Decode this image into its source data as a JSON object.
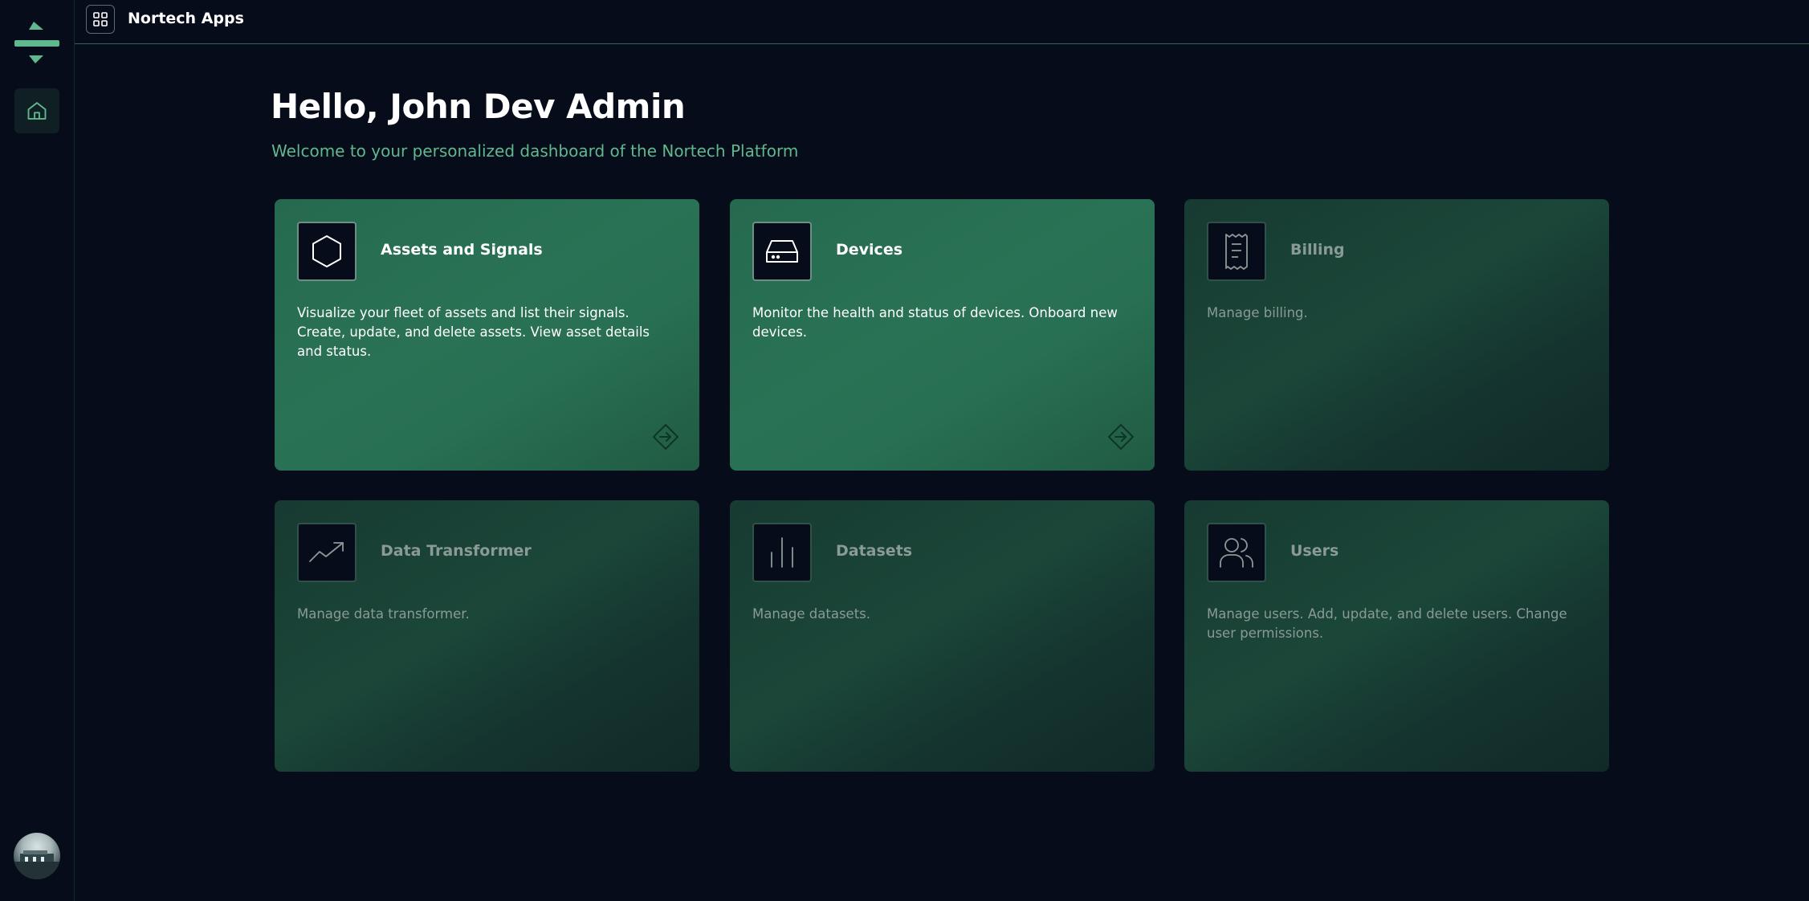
{
  "header": {
    "app_name": "Nortech Apps"
  },
  "main": {
    "greeting": "Hello, John Dev Admin",
    "subtitle": "Welcome to your personalized dashboard of the Nortech Platform"
  },
  "cards": [
    {
      "title": "Assets and Signals",
      "description": "Visualize your fleet of assets and list their signals. Create, update, and delete assets. View asset details and status.",
      "icon": "hexagon-icon",
      "enabled": true
    },
    {
      "title": "Devices",
      "description": "Monitor the health and status of devices. Onboard new devices.",
      "icon": "hard-drive-icon",
      "enabled": true
    },
    {
      "title": "Billing",
      "description": "Manage billing.",
      "icon": "receipt-icon",
      "enabled": false
    },
    {
      "title": "Data Transformer",
      "description": "Manage data transformer.",
      "icon": "trending-up-icon",
      "enabled": false
    },
    {
      "title": "Datasets",
      "description": "Manage datasets.",
      "icon": "bar-chart-icon",
      "enabled": false
    },
    {
      "title": "Users",
      "description": "Manage users. Add, update, and delete users. Change user permissions.",
      "icon": "users-icon",
      "enabled": false
    }
  ],
  "colors": {
    "background": "#070c1a",
    "accent": "#5fb88e",
    "card_enabled": "#286f53",
    "card_disabled": "#15342f"
  }
}
